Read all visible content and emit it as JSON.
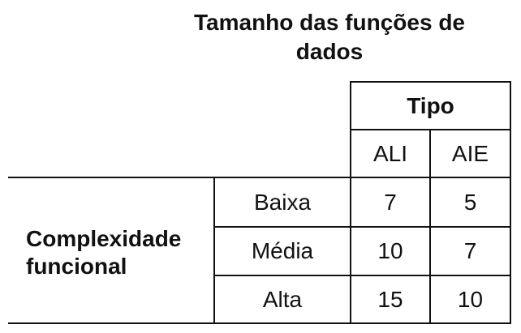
{
  "title": "Tamanho das funções de dados",
  "table": {
    "header_group": "Tipo",
    "columns": [
      "ALI",
      "AIE"
    ],
    "row_group_label": "Complexidade funcional",
    "rows": [
      {
        "label": "Baixa",
        "values": [
          "7",
          "5"
        ]
      },
      {
        "label": "Média",
        "values": [
          "10",
          "7"
        ]
      },
      {
        "label": "Alta",
        "values": [
          "15",
          "10"
        ]
      }
    ]
  }
}
